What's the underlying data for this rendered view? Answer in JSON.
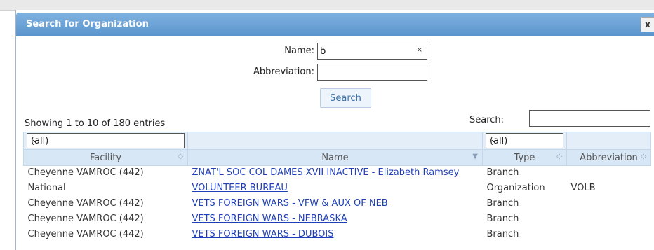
{
  "dialog": {
    "title": "Search for Organization",
    "close_label": "x"
  },
  "form": {
    "name_label": "Name:",
    "name_value": "b",
    "name_clear": "×",
    "abbr_label": "Abbreviation:",
    "abbr_value": "",
    "search_label": "Search"
  },
  "table_info": {
    "showing": "Showing 1 to 10 of 180 entries",
    "search_label": "Search:",
    "search_value": ""
  },
  "filters": {
    "facility": "(all)",
    "type": "(all)"
  },
  "columns": [
    "Facility",
    "Name",
    "Type",
    "Abbreviation"
  ],
  "rows": [
    {
      "facility": "Cheyenne VAMROC (442)",
      "name": "ZNAT'L SOC COL DAMES XVII INACTIVE - Elizabeth Ramsey",
      "type": "Branch",
      "abbr": ""
    },
    {
      "facility": "National",
      "name": "VOLUNTEER BUREAU",
      "type": "Organization",
      "abbr": "VOLB"
    },
    {
      "facility": "Cheyenne VAMROC (442)",
      "name": "VETS FOREIGN WARS - VFW & AUX OF NEB",
      "type": "Branch",
      "abbr": ""
    },
    {
      "facility": "Cheyenne VAMROC (442)",
      "name": "VETS FOREIGN WARS - NEBRASKA",
      "type": "Branch",
      "abbr": ""
    },
    {
      "facility": "Cheyenne VAMROC (442)",
      "name": "VETS FOREIGN WARS - DUBOIS",
      "type": "Branch",
      "abbr": ""
    }
  ],
  "colors": {
    "titlebar": "#6aa2d8",
    "header": "#d8e7f6",
    "link": "#1f3fb8"
  },
  "icons": {
    "close": "close-icon",
    "sort": "sort-icon",
    "dropdown": "chevron-down-icon"
  }
}
